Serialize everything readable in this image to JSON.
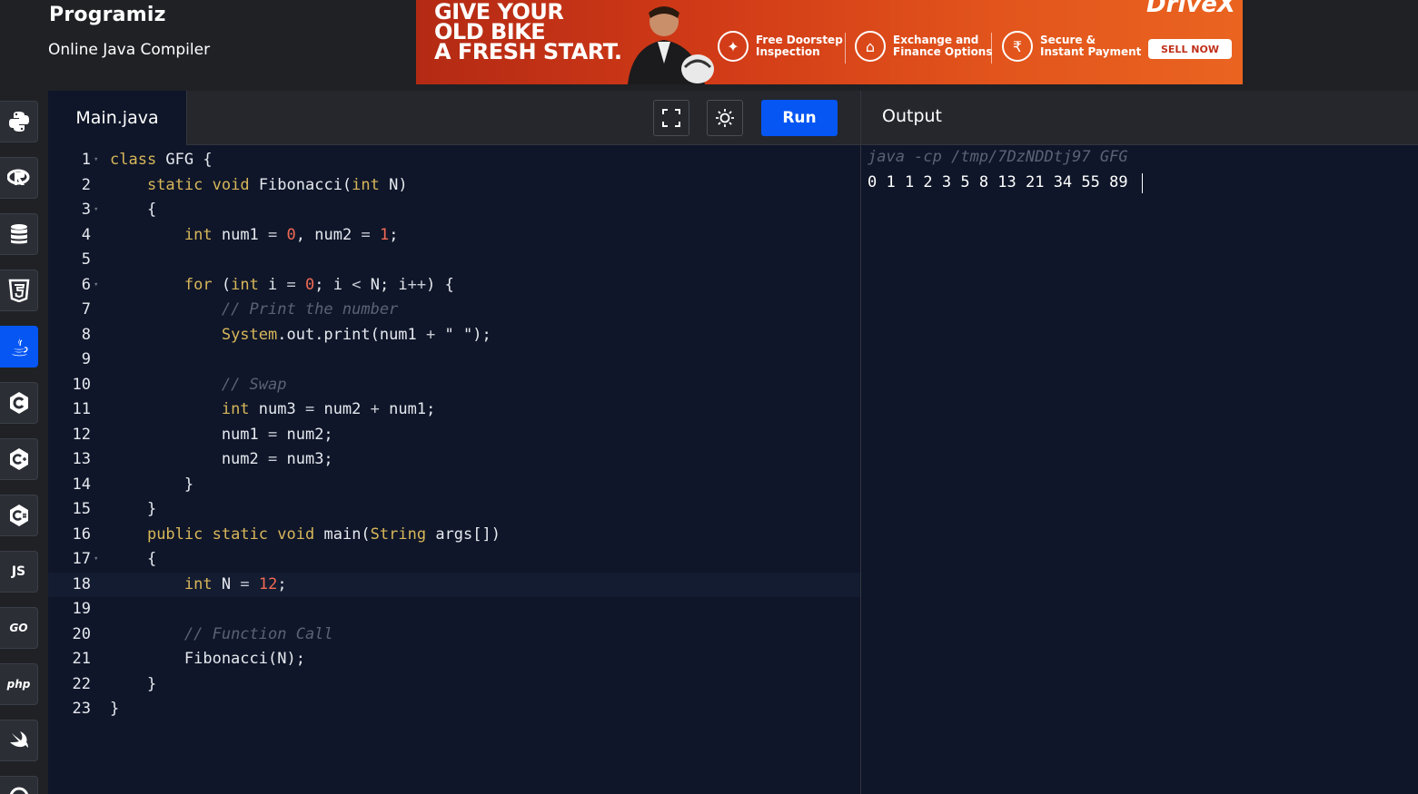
{
  "brand": {
    "logo": "Programiz",
    "subtitle": "Online Java Compiler"
  },
  "ad": {
    "headline": [
      "GIVE YOUR",
      "OLD BIKE",
      "A FRESH START."
    ],
    "features": [
      {
        "label": "Free Doorstep\nInspection",
        "icon": "wrench-icon"
      },
      {
        "label": "Exchange and\nFinance Options",
        "icon": "bank-icon"
      },
      {
        "label": "Secure &\nInstant Payment",
        "icon": "rupee-icon"
      }
    ],
    "brand_name": "DriveX",
    "cta": "SELL NOW"
  },
  "sidebar": {
    "languages": [
      {
        "name": "python",
        "icon": "python-icon"
      },
      {
        "name": "r",
        "icon": "r-icon"
      },
      {
        "name": "sql",
        "icon": "database-icon"
      },
      {
        "name": "html",
        "icon": "html5-icon"
      },
      {
        "name": "java",
        "icon": "java-icon",
        "active": true
      },
      {
        "name": "c",
        "icon": "c-icon"
      },
      {
        "name": "cpp",
        "icon": "cplusplus-icon"
      },
      {
        "name": "csharp",
        "icon": "csharp-icon"
      },
      {
        "name": "js",
        "label": "JS"
      },
      {
        "name": "go",
        "label": "GO"
      },
      {
        "name": "php",
        "label": "php"
      },
      {
        "name": "swift",
        "icon": "swift-icon"
      },
      {
        "name": "rust",
        "icon": "rust-icon"
      }
    ]
  },
  "editor": {
    "filename": "Main.java",
    "run_label": "Run",
    "fullscreen_icon": "fullscreen-icon",
    "theme_icon": "sun-icon",
    "lines": [
      "class GFG {",
      "    static void Fibonacci(int N)",
      "    {",
      "        int num1 = 0, num2 = 1;",
      "",
      "        for (int i = 0; i < N; i++) {",
      "            // Print the number",
      "            System.out.print(num1 + \" \");",
      "",
      "            // Swap",
      "            int num3 = num2 + num1;",
      "            num1 = num2;",
      "            num2 = num3;",
      "        }",
      "    }",
      "    public static void main(String args[])",
      "    {",
      "        int N = 12;",
      "",
      "        // Function Call",
      "        Fibonacci(N);",
      "    }",
      "}"
    ],
    "fold_lines": [
      1,
      3,
      6,
      17
    ],
    "active_line": 18
  },
  "output": {
    "title": "Output",
    "command": "java -cp /tmp/7DzNDDtj97 GFG",
    "result": "0 1 1 2 3 5 8 13 21 34 55 89 "
  },
  "colors": {
    "accent": "#0556f3",
    "keyword": "#d8b75a",
    "number": "#f26a55",
    "comment": "#5b6275",
    "editor_bg": "#0f1629",
    "panel_bg": "#25272d"
  }
}
